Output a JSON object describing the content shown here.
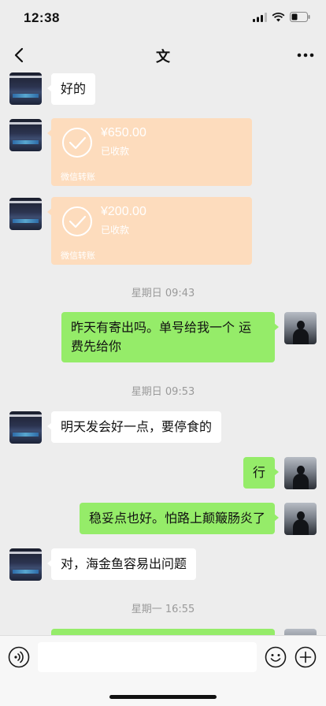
{
  "status_bar": {
    "time": "12:38"
  },
  "header": {
    "title": "文",
    "back_icon": "chevron-left-icon",
    "more_icon": "more-dots-icon"
  },
  "messages": [
    {
      "side": "left",
      "type": "text",
      "text": "好的"
    },
    {
      "side": "left",
      "type": "transfer",
      "amount": "¥650.00",
      "status": "已收款",
      "brand": "微信转账"
    },
    {
      "side": "left",
      "type": "transfer",
      "amount": "¥200.00",
      "status": "已收款",
      "brand": "微信转账"
    },
    {
      "type": "time",
      "text": "星期日 09:43"
    },
    {
      "side": "right",
      "type": "text",
      "line1": "昨天有寄出吗。单号给我一个 运",
      "line2": "费先给你"
    },
    {
      "type": "time",
      "text": "星期日 09:53"
    },
    {
      "side": "left",
      "type": "text",
      "text": "明天发会好一点，要停食的"
    },
    {
      "side": "right",
      "type": "text",
      "text": "行"
    },
    {
      "side": "right",
      "type": "text",
      "text": "稳妥点也好。怕路上颠簸肠炎了"
    },
    {
      "side": "left",
      "type": "text",
      "text": "对，海金鱼容易出问题"
    },
    {
      "type": "time",
      "text": "星期一 16:55"
    }
  ],
  "input_bar": {
    "value": "",
    "voice_icon": "voice-icon",
    "emoji_icon": "emoji-icon",
    "plus_icon": "plus-icon"
  },
  "colors": {
    "background": "#ededed",
    "outgoing_bubble": "#95ec69",
    "incoming_bubble": "#ffffff",
    "transfer_card": "#fddcbd"
  }
}
